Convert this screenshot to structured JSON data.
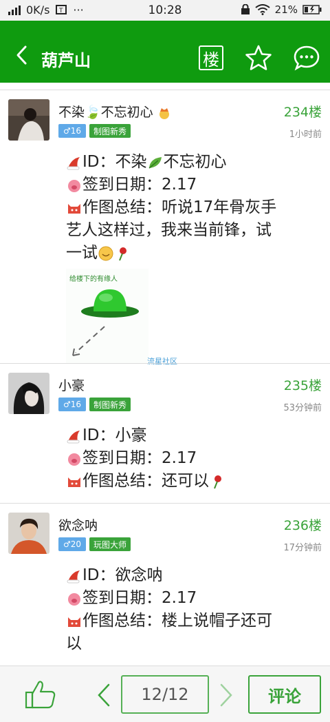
{
  "status_bar": {
    "network_speed": "0K/s",
    "time": "10:28",
    "battery": "21%",
    "more": "···"
  },
  "header": {
    "title": "葫芦山",
    "floor_button": "楼"
  },
  "posts": [
    {
      "username": "不染🍃不忘初心",
      "floor": "234楼",
      "time_ago": "1小时前",
      "age_badge": "♂16",
      "title_badge": "制图新秀",
      "lines": [
        "ID：不染",
        "不忘初心",
        "签到日期：2.17",
        "作图总结：听说17年骨灰手",
        "艺人这样过，我来当前锋，试",
        "一试"
      ],
      "image_caption": "给楼下的有缘人",
      "watermark": "流星社区"
    },
    {
      "username": "小豪",
      "floor": "235楼",
      "time_ago": "53分钟前",
      "age_badge": "♂16",
      "title_badge": "制图新秀",
      "lines": [
        "ID：小豪",
        "签到日期：2.17",
        "作图总结：还可以"
      ]
    },
    {
      "username": "欲念呐",
      "floor": "236楼",
      "time_ago": "17分钟前",
      "age_badge": "♂20",
      "title_badge": "玩图大师",
      "lines": [
        "ID：欲念呐",
        "签到日期：2.17",
        "作图总结：楼上说帽子还可",
        "以"
      ]
    }
  ],
  "bottom": {
    "page": "12/12",
    "comment_button": "评论"
  },
  "colors": {
    "brand_green": "#0f9b0f",
    "floor_green": "#3aa33a",
    "age_badge_blue": "#5fa9e8"
  }
}
